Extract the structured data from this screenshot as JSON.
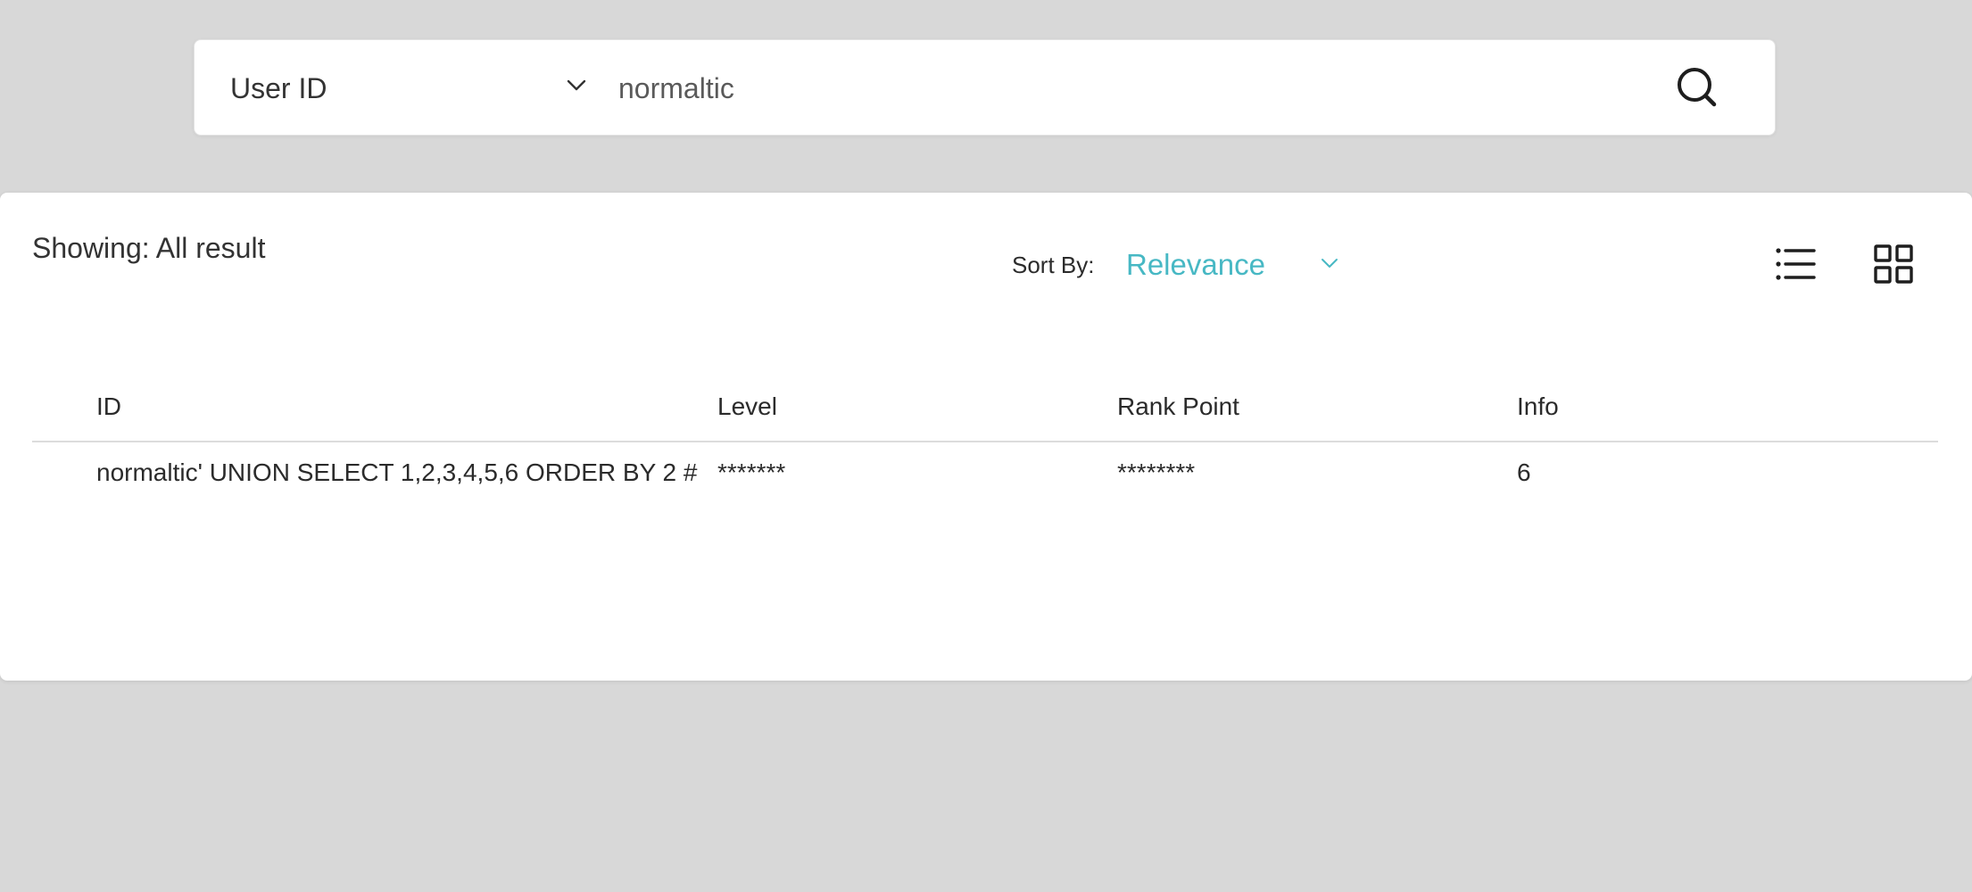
{
  "search": {
    "type_label": "User ID",
    "query_value": "normaltic",
    "search_icon": "search-icon",
    "chevron_icon": "chevron-down-icon"
  },
  "results": {
    "showing_label": "Showing: All result",
    "sort_label": "Sort By:",
    "sort_value": "Relevance",
    "accent_color": "#47b8c4",
    "view_icons": [
      "list-view-icon",
      "grid-view-icon"
    ]
  },
  "table": {
    "columns": [
      "ID",
      "Level",
      "Rank Point",
      "Info"
    ],
    "rows": [
      {
        "id": "normaltic' UNION SELECT 1,2,3,4,5,6 ORDER BY 2 #",
        "level": "*******",
        "rank_point": "********",
        "info": "6"
      }
    ]
  }
}
